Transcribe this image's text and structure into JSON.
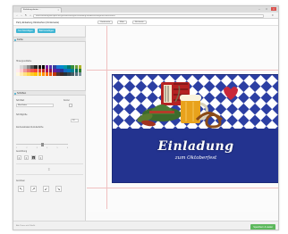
{
  "browser": {
    "tab_title": "Einladungskarten ...",
    "tab_close": "×",
    "url": "www.einladungsbeispiele.de/gestalten/designer/einladung-oktoberfest-bayerisch-blau-weiss",
    "back": "‹",
    "forward": "›",
    "reload": "↻",
    "home": "⌂",
    "menu": "≡",
    "minimize": "–",
    "maximize": "□",
    "close": "×"
  },
  "header": {
    "title": "Party Einladung Oktoberfest (Vorderseite)",
    "segments": [
      "Vorderseite",
      "Mitte",
      "Rückseite"
    ]
  },
  "panel": {
    "buttons": [
      "Text hinzufügen",
      "Bild hinzufügen"
    ],
    "sections": {
      "colors": "Farbe",
      "text": "Schriften",
      "arrange": "Anordnen"
    },
    "labels": {
      "background": "Hintergrundfarbe",
      "font": "Schriftart",
      "font_value": "Blackletter",
      "outline": "Kontur",
      "size": "Schriftgröße",
      "size_value": "18",
      "spacing": "Zeichenabstand & Zeilenhöhe",
      "align": "Ausrichtung"
    },
    "ticks": [
      "1",
      "2",
      "3",
      "4",
      "5",
      "6"
    ],
    "align_icons": [
      "≡",
      "≡",
      "≡",
      "≡"
    ],
    "arrows": [
      "↖",
      "↗",
      "↙",
      "↘"
    ],
    "mid_icon": "⇳",
    "swatches": [
      "#f2f2f2",
      "#d9d9d9",
      "#bfbfbf",
      "#8c8c8c",
      "#595959",
      "#262626",
      "#1a1a1a",
      "#000000",
      "#7b1fa2",
      "#512da8",
      "#303f9f",
      "#1976d2",
      "#0288d1",
      "#0097a7",
      "#00796b",
      "#388e3c",
      "#689f38",
      "#afb42b",
      "#ffebee",
      "#ffcdd2",
      "#ef9a9a",
      "#e57373",
      "#ef5350",
      "#f44336",
      "#e53935",
      "#c62828",
      "#ad1457",
      "#880e4f",
      "#6a1b9a",
      "#4527a0",
      "#283593",
      "#1565c0",
      "#0277bd",
      "#00838f",
      "#00695c",
      "#2e7d32",
      "#fff8e1",
      "#ffecb3",
      "#ffe082",
      "#ffd54f",
      "#ffca28",
      "#ffc107",
      "#ffb300",
      "#ff8f00",
      "#ff6f00",
      "#e65100",
      "#bf360c",
      "#4e342e",
      "#3e2723",
      "#263238",
      "#37474f",
      "#455a64",
      "#546e7a",
      "#78909c"
    ]
  },
  "card": {
    "title": "Einladung",
    "subtitle": "zum Oktoberfest",
    "colors": {
      "blue": "#23338f",
      "white": "#ffffff"
    }
  },
  "footer": {
    "note": "Alle Preise inkl. MwSt.",
    "next_button": "Speichern & weiter"
  }
}
